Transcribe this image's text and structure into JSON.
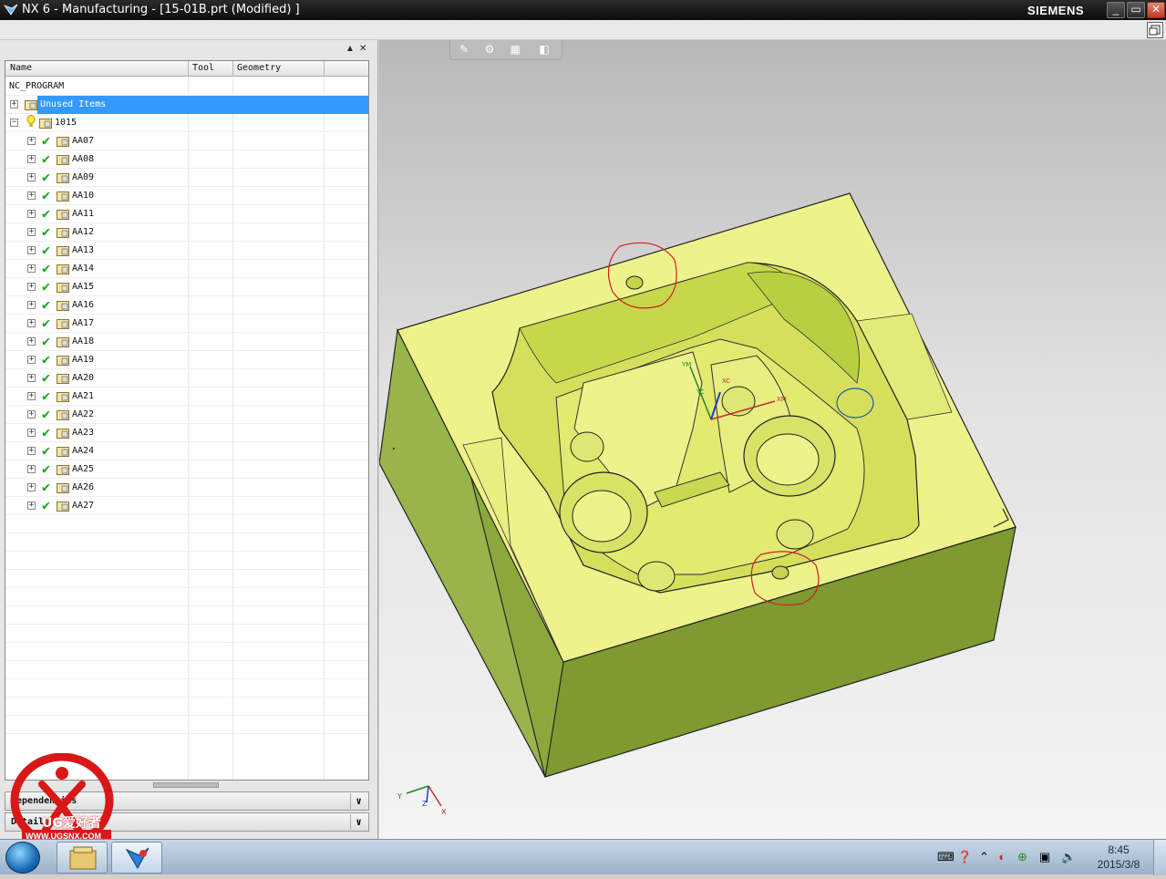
{
  "window": {
    "title": "NX 6 - Manufacturing - [15-01B.prt (Modified) ]",
    "brand": "SIEMENS",
    "controls": {
      "minimize": "_",
      "maximize": "▭",
      "close": "✕"
    }
  },
  "navigator": {
    "controls": {
      "collapse": "▲",
      "close": "✕"
    },
    "columns": [
      "Name",
      "Tool",
      "Geometry"
    ],
    "root": "NC_PROGRAM",
    "unused": "Unused Items",
    "group": "1015",
    "operations": [
      "AA07",
      "AA08",
      "AA09",
      "AA10",
      "AA11",
      "AA12",
      "AA13",
      "AA14",
      "AA15",
      "AA16",
      "AA17",
      "AA18",
      "AA19",
      "AA20",
      "AA21",
      "AA22",
      "AA23",
      "AA24",
      "AA25",
      "AA26",
      "AA27"
    ],
    "sections": [
      "Dependencies",
      "Details"
    ]
  },
  "viewport": {
    "wcs_labels": [
      "YM",
      "YC",
      "XM",
      "XC"
    ],
    "triad_labels": [
      "Y",
      "Z",
      "X"
    ],
    "body_color": "#eef28a",
    "side_color": "#8aa63a",
    "markup_color": "#d02020"
  },
  "watermark": {
    "logo_text": "UG爱好者",
    "url_text": "WWW.UGSNX.COM"
  },
  "taskbar": {
    "clock_time": "8:45",
    "clock_date": "2015/3/8"
  }
}
